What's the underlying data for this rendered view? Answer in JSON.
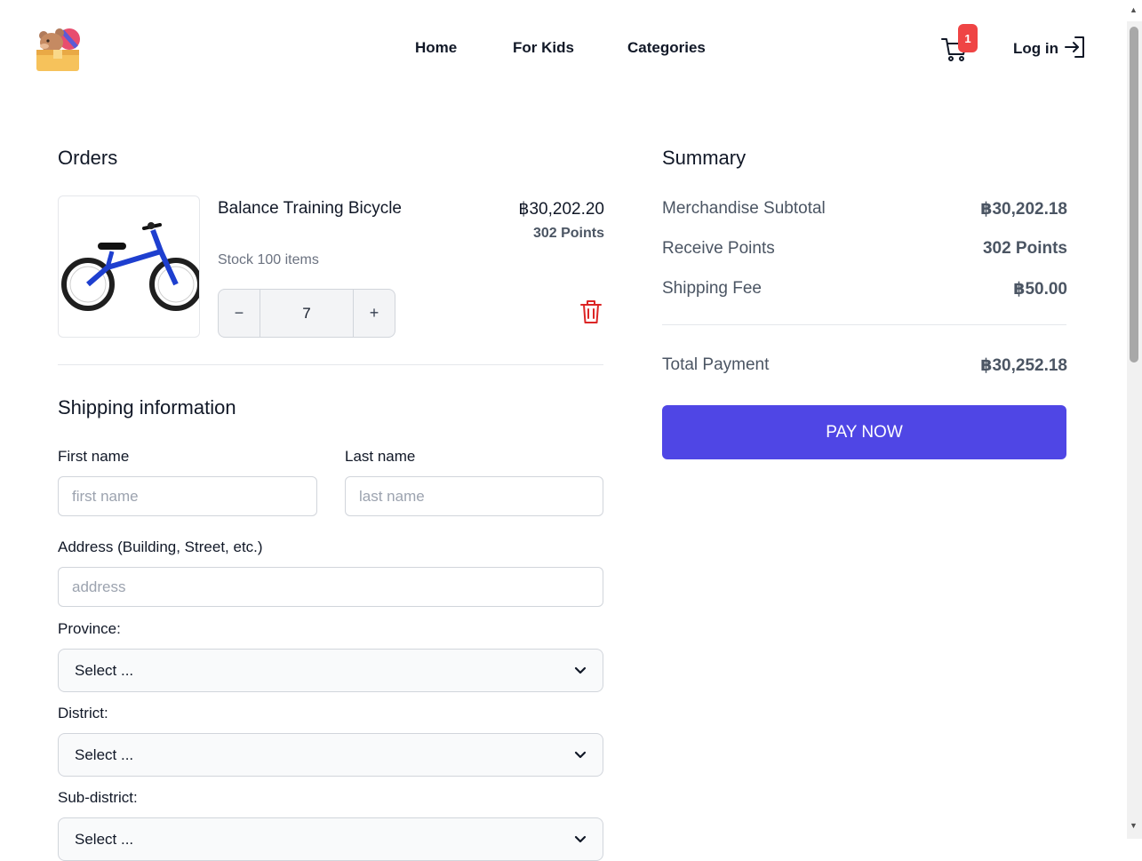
{
  "header": {
    "logo_icon": "teddy-bear-toy-box-logo",
    "nav": [
      "Home",
      "For Kids",
      "Categories"
    ],
    "cart_icon": "shopping-cart-icon",
    "cart_count": "1",
    "login_label": "Log in",
    "login_icon": "login-icon"
  },
  "orders": {
    "title": "Orders",
    "item": {
      "name": "Balance Training Bicycle",
      "price": "฿30,202.20",
      "points": "302 Points",
      "stock": "Stock 100 items",
      "quantity": "7",
      "minus_label": "−",
      "plus_label": "+",
      "delete_icon": "trash-icon"
    }
  },
  "shipping": {
    "title": "Shipping information",
    "first_name_label": "First name",
    "first_name_placeholder": "first name",
    "last_name_label": "Last name",
    "last_name_placeholder": "last name",
    "address_label": "Address (Building, Street, etc.)",
    "address_placeholder": "address",
    "province_label": "Province:",
    "province_value": "Select ...",
    "district_label": "District:",
    "district_value": "Select ...",
    "subdistrict_label": "Sub-district:",
    "subdistrict_value": "Select ..."
  },
  "summary": {
    "title": "Summary",
    "rows": [
      {
        "label": "Merchandise Subtotal",
        "value": "฿30,202.18"
      },
      {
        "label": "Receive Points",
        "value": "302 Points"
      },
      {
        "label": "Shipping Fee",
        "value": "฿50.00"
      }
    ],
    "total_label": "Total Payment",
    "total_value": "฿30,252.18",
    "pay_label": "PAY NOW"
  },
  "colors": {
    "accent": "#4f46e5",
    "badge": "#ef4444",
    "delete": "#dc2626"
  }
}
